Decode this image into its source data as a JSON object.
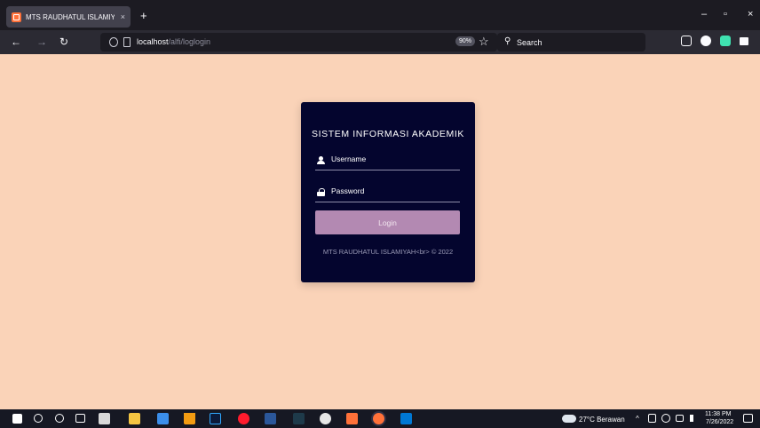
{
  "browser": {
    "tab_title": "MTS RAUDHATUL ISLAMIYAH<",
    "tab_close": "×",
    "new_tab": "+",
    "win_minimize": "–",
    "win_restore": "▫",
    "win_close": "×",
    "back": "←",
    "forward": "→",
    "reload": "↻",
    "url_host": "localhost",
    "url_path": "/alfi/loglogin",
    "zoom": "90%",
    "star": "☆",
    "search_placeholder": "Search",
    "search_glyph": "⚲"
  },
  "login": {
    "title": "SISTEM INFORMASI AKADEMIK",
    "username_placeholder": "Username",
    "password_placeholder": "Password",
    "button": "Login",
    "footer": "MTS RAUDHATUL ISLAMIYAH<br> © 2022"
  },
  "taskbar": {
    "weather": "27°C  Berawan",
    "tray_chevron": "^",
    "time": "11:38 PM",
    "date": "7/26/2022"
  },
  "colors": {
    "page_bg": "#fad3b8",
    "card_bg": "#04052e",
    "button_bg": "#b389b2"
  }
}
